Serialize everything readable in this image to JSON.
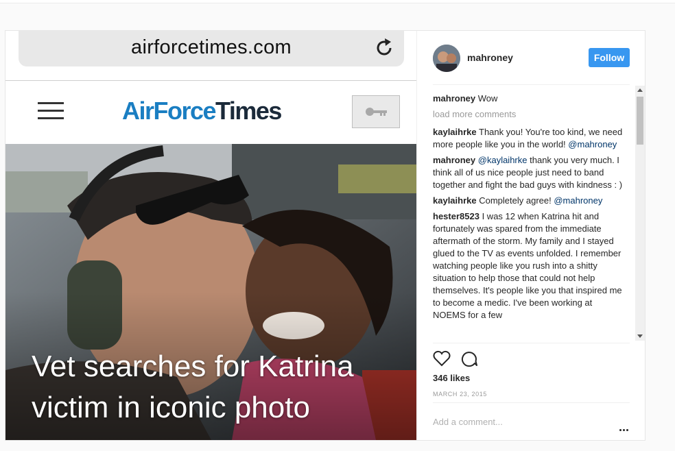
{
  "browser": {
    "url": "airforcetimes.com"
  },
  "site": {
    "logo_part1": "AirForce",
    "logo_part2": "Times",
    "headline_line1": "Vet searches for Katrina",
    "headline_line2": "victim in iconic photo"
  },
  "post": {
    "username": "mahroney",
    "follow_label": "Follow",
    "load_more": "load more comments",
    "comments": [
      {
        "user": "mahroney",
        "text": "Wow"
      },
      {
        "user": "kaylaihrke",
        "text": "Thank you! You're too kind, we need more people like you in the world!",
        "mention": "@mahroney"
      },
      {
        "user": "mahroney",
        "mention": "@kaylaihrke",
        "text": "thank you very much. I think all of us nice people just need to band together and fight the bad guys with kindness : )"
      },
      {
        "user": "kaylaihrke",
        "text": "Completely agree!",
        "mention": "@mahroney"
      },
      {
        "user": "hester8523",
        "text": "I was 12 when Katrina hit and fortunately was spared from the immediate aftermath of the storm. My family and I stayed glued to the TV as events unfolded. I remember watching people like you rush into a shitty situation to help those that could not help themselves. It's people like you that inspired me to become a medic. I've been working at NOEMS for a few"
      }
    ],
    "likes": "346 likes",
    "date": "MARCH 23, 2015",
    "add_comment_placeholder": "Add a comment..."
  },
  "icons": {
    "reload": "reload-icon",
    "menu": "hamburger-menu-icon",
    "key": "key-icon",
    "heart": "heart-icon",
    "comment": "comment-icon",
    "more": "more-options-icon"
  },
  "colors": {
    "follow_button": "#3897f0",
    "logo_blue": "#1a7ec2",
    "logo_dark": "#1b2a3a",
    "mention": "#003569"
  }
}
